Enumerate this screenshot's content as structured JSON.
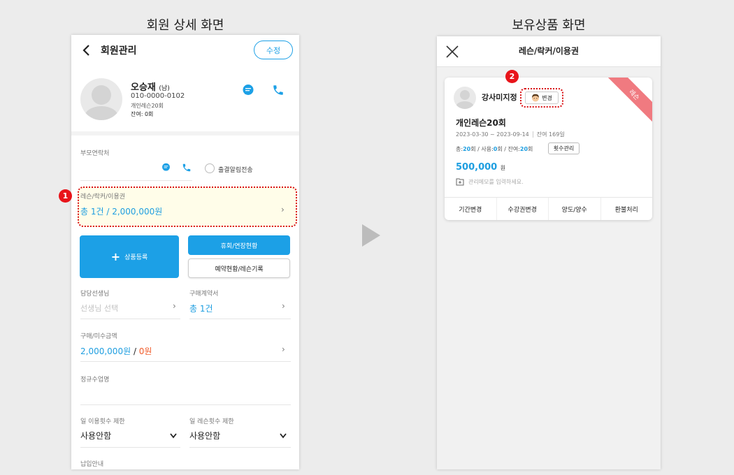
{
  "captions": {
    "left": "회원 상세 화면",
    "right": "보유상품 화면"
  },
  "member_detail": {
    "header": {
      "title": "회원관리",
      "edit_label": "수정"
    },
    "profile": {
      "name": "오승재",
      "gender": "(남)",
      "phone": "010-0000-0102",
      "product": "개인레슨20회",
      "remaining": "잔여: 0회"
    },
    "parent_contact": {
      "label": "부모연락처",
      "attendance_label": "출결알림전송"
    },
    "callout_1": "1",
    "products": {
      "label": "레슨/락커/이용권",
      "summary": "총 1건 / 2,000,000원"
    },
    "buttons": {
      "register": "상품등록",
      "rest_extend": "휴회/연장현황",
      "reservation": "예약현황/레슨기록"
    },
    "trainer": {
      "label": "담당선생님",
      "placeholder": "선생님 선택"
    },
    "contract": {
      "label": "구매계약서",
      "value": "총 1건"
    },
    "purchase": {
      "label": "구매/미수금액",
      "paid": "2,000,000원",
      "separator": " / ",
      "unpaid": "0원"
    },
    "regular_class": {
      "label": "정규수업명"
    },
    "daily_use_limit": {
      "label": "일 이용횟수 제한",
      "value": "사용안함"
    },
    "daily_lesson_limit": {
      "label": "일 레슨횟수 제한",
      "value": "사용안함"
    },
    "payment_guide": {
      "label": "납입안내"
    }
  },
  "owned_products": {
    "header": {
      "title": "레슨/락커/이용권"
    },
    "callout_2": "2",
    "card": {
      "ribbon": "레슨",
      "trainer": "강사미지정",
      "change_label": "변경",
      "product_name": "개인레슨20회",
      "period": "2023-03-30 ~ 2023-09-14",
      "remaining_days": "잔여 169일",
      "counts_prefix_total": "총:",
      "total": "20",
      "counts_prefix_used": "회 / 사용:",
      "used": "0",
      "counts_prefix_left": "회 / 잔여:",
      "left": "20",
      "counts_suffix": "회",
      "count_manage": "횟수관리",
      "price": "500,000",
      "currency": "원",
      "memo_placeholder": "관리메모를 입력하세요.",
      "actions": [
        "기간변경",
        "수강권변경",
        "양도/양수",
        "환불처리"
      ]
    }
  },
  "colors": {
    "accent": "#1ca0e6",
    "highlight": "#d90f12",
    "ribbon": "#f07a80",
    "unpaid": "#f05a28"
  }
}
